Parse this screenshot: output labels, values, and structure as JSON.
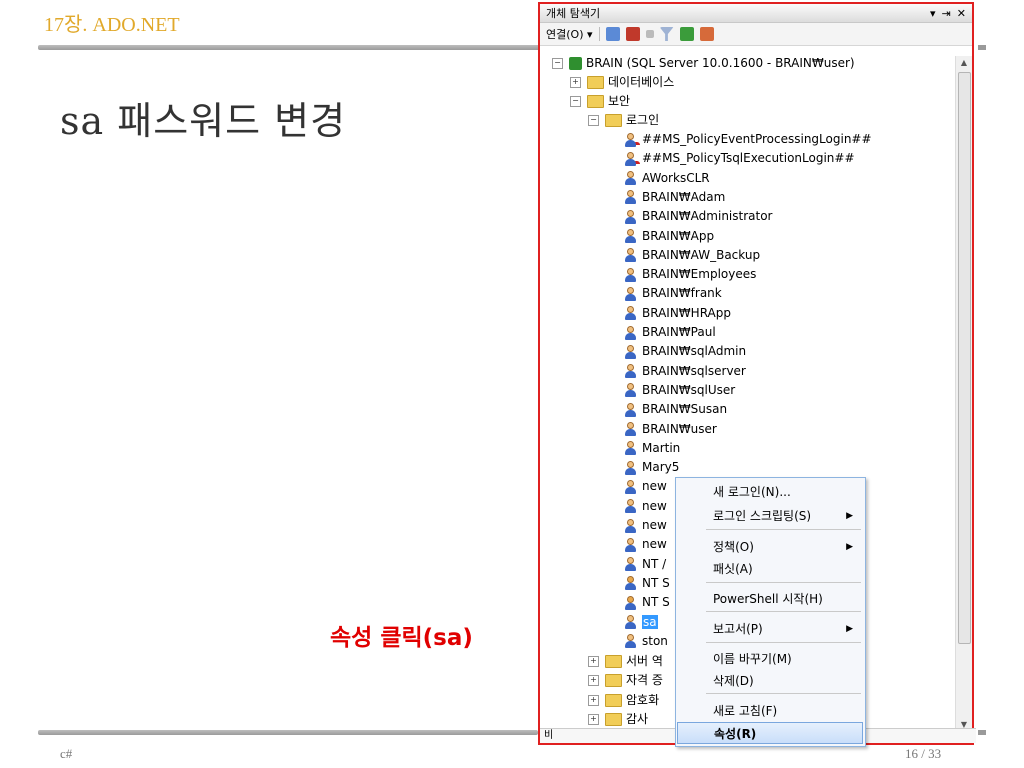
{
  "slide": {
    "header": "17장. ADO.NET",
    "title": "sa 패스워드 변경",
    "callout": "속성 클릭(sa)",
    "footer_left": "c#",
    "footer_right": "16 / 33"
  },
  "panel": {
    "title": "개체 탐색기",
    "controls": [
      "▾",
      "⇥",
      "✕"
    ],
    "toolbar": {
      "connect_label": "연결(O) ▾"
    },
    "status": "비"
  },
  "tree": {
    "server": "BRAIN (SQL Server 10.0.1600 - BRAIN₩user)",
    "databases": "데이터베이스",
    "security": "보안",
    "logins": "로그인",
    "login_items": [
      "##MS_PolicyEventProcessingLogin##",
      "##MS_PolicyTsqlExecutionLogin##",
      "AWorksCLR",
      "BRAIN₩Adam",
      "BRAIN₩Administrator",
      "BRAIN₩App",
      "BRAIN₩AW_Backup",
      "BRAIN₩Employees",
      "BRAIN₩frank",
      "BRAIN₩HRApp",
      "BRAIN₩Paul",
      "BRAIN₩sqlAdmin",
      "BRAIN₩sqlserver",
      "BRAIN₩sqlUser",
      "BRAIN₩Susan",
      "BRAIN₩user",
      "Martin",
      "Mary5",
      "new",
      "new",
      "new",
      "new",
      "NT /",
      "NT S",
      "NT S",
      "sa",
      "ston"
    ],
    "folders_after": [
      "서버 역",
      "자격 증",
      "암호화",
      "감사"
    ]
  },
  "context_menu": {
    "items": [
      {
        "label": "새 로그인(N)...",
        "submenu": false
      },
      {
        "label": "로그인 스크립팅(S)",
        "submenu": true
      },
      {
        "label": "정책(O)",
        "submenu": true
      },
      {
        "label": "패싯(A)",
        "submenu": false
      },
      {
        "label": "PowerShell 시작(H)",
        "submenu": false
      },
      {
        "label": "보고서(P)",
        "submenu": true
      },
      {
        "label": "이름 바꾸기(M)",
        "submenu": false
      },
      {
        "label": "삭제(D)",
        "submenu": false
      },
      {
        "label": "새로 고침(F)",
        "submenu": false
      },
      {
        "label": "속성(R)",
        "submenu": false
      }
    ],
    "arrow_glyph": "▶"
  },
  "colors": {
    "header": "#e1a92b",
    "callout": "#e00000",
    "panel_border": "#e02020",
    "selection": "#3399ff"
  }
}
